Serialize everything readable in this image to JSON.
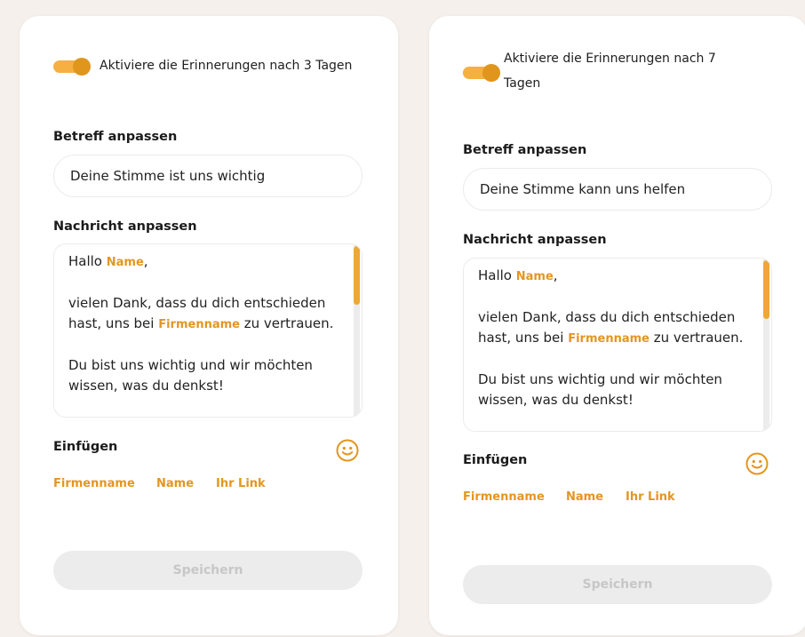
{
  "colors": {
    "accent": "#e39620",
    "toggle_track": "#f5b041",
    "page_bg": "#f6f0ec",
    "disabled_button_bg": "#ececec",
    "disabled_button_text": "#c7c7c7"
  },
  "cards": [
    {
      "toggle": {
        "on": true,
        "label": "Aktiviere die Erinnerungen nach 3 Tagen"
      },
      "subject": {
        "label": "Betreff anpassen",
        "value": "Deine Stimme ist uns wichtig"
      },
      "message": {
        "label": "Nachricht anpassen",
        "greeting": "Hallo ",
        "name_placeholder": "Name",
        "greeting_end": ",",
        "line2_a": "vielen Dank, dass du dich entschieden hast, uns bei ",
        "company_placeholder": "Firmenname",
        "line2_b": " zu vertrauen.",
        "line3": "Du bist uns wichtig und wir möchten wissen, was du denkst!"
      },
      "insert": {
        "label": "Einfügen",
        "emoji_icon": "smiley-icon",
        "links": [
          "Firmenname",
          "Name",
          "Ihr Link"
        ]
      },
      "save_label": "Speichern"
    },
    {
      "toggle": {
        "on": true,
        "label_line1": "Aktiviere die Erinnerungen nach 7",
        "label_line2": "Tagen"
      },
      "subject": {
        "label": "Betreff anpassen",
        "value": "Deine Stimme kann uns helfen"
      },
      "message": {
        "label": "Nachricht anpassen",
        "greeting": "Hallo ",
        "name_placeholder": "Name",
        "greeting_end": ",",
        "line2_a": "vielen Dank, dass du dich entschieden hast, uns bei ",
        "company_placeholder": "Firmenname",
        "line2_b": " zu vertrauen.",
        "line3": "Du bist uns wichtig und wir möchten wissen, was du denkst!"
      },
      "insert": {
        "label": "Einfügen",
        "emoji_icon": "smiley-icon",
        "links": [
          "Firmenname",
          "Name",
          "Ihr Link"
        ]
      },
      "save_label": "Speichern"
    }
  ]
}
